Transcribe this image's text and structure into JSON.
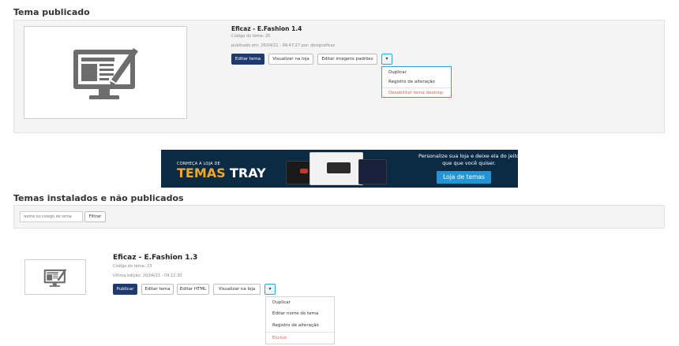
{
  "published": {
    "section_title": "Tema publicado",
    "theme_name": "Eficaz - E.Fashion 1.4",
    "theme_code": "Código do tema: 25",
    "published_info": "publicado em: 26/04/21 - 09:47:27 por: designeficaz",
    "buttons": {
      "edit": "Editar tema",
      "view": "Visualizar na loja",
      "edit_images": "Editar imagens padrões",
      "caret": "▾"
    },
    "menu": [
      "Duplicar",
      "Registro de alteração"
    ],
    "menu_danger": "Desabilitar tema desktop"
  },
  "banner": {
    "small_text": "CONHEÇA A LOJA DE",
    "big_word1": "TEMAS",
    "big_word2": "TRAY",
    "tagline": "Personalize sua loja e deixe ela do jeito que que você quiser.",
    "cta": "Loja de temas"
  },
  "installed": {
    "section_title": "Temas instalados e não publicados",
    "search_placeholder": "Nome ou código do tema",
    "filter_button": "Filtrar",
    "theme": {
      "name": "Eficaz - E.Fashion 1.3",
      "code": "Código do tema: 23",
      "last_edit": "Última edição: 20/04/21 - 09:11:30",
      "buttons": {
        "publish": "Publicar",
        "edit": "Editar tema",
        "edit_html": "Editar HTML",
        "view": "Visualizar na loja",
        "caret": "▾"
      },
      "menu": [
        "Duplicar",
        "Editar nome do tema",
        "Registro de alteração"
      ],
      "menu_danger": "Excluir"
    }
  },
  "colors": {
    "primary": "#1f3a6e",
    "accent": "#2fa4d7",
    "danger": "#e0614f",
    "banner_bg": "#0b2a44",
    "banner_orange": "#f5a623",
    "banner_cta": "#2494d4"
  },
  "icons": {
    "theme_thumb": "monitor-brush-icon",
    "caret": "chevron-down-icon"
  }
}
